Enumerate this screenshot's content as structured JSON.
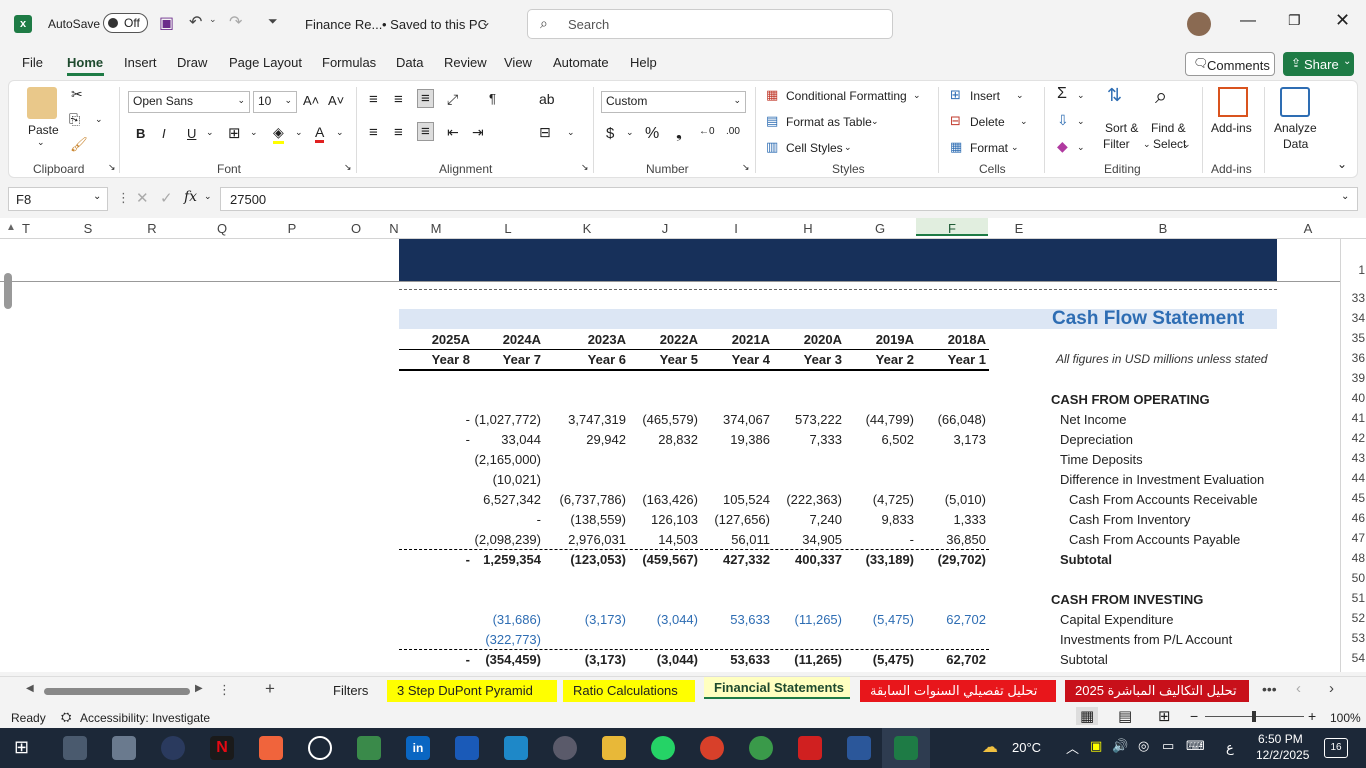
{
  "titlebar": {
    "autosave_label": "AutoSave",
    "autosave_state": "Off",
    "filename": "Finance Re...",
    "saved_status": "• Saved to this PC",
    "search_placeholder": "Search"
  },
  "ribbon_tabs": [
    "File",
    "Home",
    "Insert",
    "Draw",
    "Page Layout",
    "Formulas",
    "Data",
    "Review",
    "View",
    "Automate",
    "Help"
  ],
  "active_tab": "Home",
  "comments_label": "Comments",
  "share_label": "Share",
  "ribbon": {
    "clipboard": {
      "label": "Clipboard",
      "paste": "Paste"
    },
    "font": {
      "label": "Font",
      "name": "Open Sans",
      "size": "10"
    },
    "alignment": {
      "label": "Alignment"
    },
    "number": {
      "label": "Number",
      "format": "Custom"
    },
    "styles": {
      "label": "Styles",
      "conditional": "Conditional Formatting",
      "format_table": "Format as Table",
      "cell_styles": "Cell Styles"
    },
    "cells": {
      "label": "Cells",
      "insert": "Insert",
      "delete": "Delete",
      "format": "Format"
    },
    "editing": {
      "label": "Editing",
      "sort": "Sort &",
      "sort2": "Filter",
      "find": "Find &",
      "find2": "Select"
    },
    "addins": {
      "label": "Add-ins",
      "btn": "Add-ins"
    },
    "analyze": {
      "line1": "Analyze",
      "line2": "Data"
    }
  },
  "formula_bar": {
    "name_box": "F8",
    "fx": "fx",
    "value": "27500"
  },
  "columns": [
    "T",
    "S",
    "R",
    "Q",
    "P",
    "O",
    "N",
    "M",
    "L",
    "K",
    "J",
    "I",
    "H",
    "G",
    "F",
    "E",
    "B",
    "A"
  ],
  "rows": [
    "1",
    "33",
    "34",
    "35",
    "36",
    "39",
    "40",
    "41",
    "42",
    "43",
    "44",
    "45",
    "46",
    "47",
    "48",
    "50",
    "51",
    "52",
    "53",
    "54"
  ],
  "sheet": {
    "title": "Cash Flow Statement",
    "note": "All figures in USD millions unless stated",
    "years": [
      "2025A",
      "2024A",
      "2023A",
      "2022A",
      "2021A",
      "2020A",
      "2019A",
      "2018A"
    ],
    "year_labels": [
      "Year 8",
      "Year 7",
      "Year 6",
      "Year 5",
      "Year 4",
      "Year 3",
      "Year 2",
      "Year 1"
    ],
    "section_operating": "CASH FROM OPERATING",
    "section_investing": "CASH FROM INVESTING",
    "lines": [
      {
        "label": "Net Income",
        "values": [
          "-",
          "(1,027,772)",
          "3,747,319",
          "(465,579)",
          "374,067",
          "573,222",
          "(44,799)",
          "(66,048)"
        ]
      },
      {
        "label": "Depreciation",
        "values": [
          "-",
          "33,044",
          "29,942",
          "28,832",
          "19,386",
          "7,333",
          "6,502",
          "3,173"
        ]
      },
      {
        "label": "Time Deposits",
        "values": [
          "",
          "(2,165,000)",
          "",
          "",
          "",
          "",
          "",
          ""
        ]
      },
      {
        "label": "Difference in Investment Evaluation",
        "values": [
          "",
          "(10,021)",
          "",
          "",
          "",
          "",
          "",
          ""
        ]
      },
      {
        "label": "Cash From Accounts Receivable",
        "values": [
          "",
          "6,527,342",
          "(6,737,786)",
          "(163,426)",
          "105,524",
          "(222,363)",
          "(4,725)",
          "(5,010)"
        ]
      },
      {
        "label": "Cash From Inventory",
        "values": [
          "",
          "-",
          "(138,559)",
          "126,103",
          "(127,656)",
          "7,240",
          "9,833",
          "1,333"
        ]
      },
      {
        "label": "Cash From Accounts Payable",
        "values": [
          "",
          "(2,098,239)",
          "2,976,031",
          "14,503",
          "56,011",
          "34,905",
          "-",
          "36,850"
        ]
      },
      {
        "label": "Subtotal",
        "values": [
          "-",
          "1,259,354",
          "(123,053)",
          "(459,567)",
          "427,332",
          "400,337",
          "(33,189)",
          "(29,702)"
        ]
      },
      {
        "label": "Capital Expenditure",
        "values": [
          "",
          "(31,686)",
          "(3,173)",
          "(3,044)",
          "53,633",
          "(11,265)",
          "(5,475)",
          "62,702"
        ]
      },
      {
        "label": "Investments from P/L Account",
        "values": [
          "",
          "(322,773)",
          "",
          "",
          "",
          "",
          "",
          ""
        ]
      },
      {
        "label": "Subtotal",
        "values": [
          "-",
          "(354,459)",
          "(3,173)",
          "(3,044)",
          "53,633",
          "(11,265)",
          "(5,475)",
          "62,702"
        ]
      }
    ]
  },
  "sheet_tabs": [
    {
      "label": "Filters",
      "color": "#f3f3f3"
    },
    {
      "label": "3 Step DuPont Pyramid",
      "color": "#ffff00"
    },
    {
      "label": "Ratio Calculations",
      "color": "#ffff00"
    },
    {
      "label": "Financial Statements",
      "color": "#ffffc0"
    },
    {
      "label": "تحليل تفصيلي السنوات السابقة",
      "color": "#e8161b"
    },
    {
      "label": "تحليل التكاليف المباشرة 2025",
      "color": "#c8101a"
    }
  ],
  "status": {
    "ready": "Ready",
    "accessibility": "Accessibility: Investigate",
    "zoom": "100%"
  },
  "taskbar": {
    "weather": "20°C",
    "time": "6:50 PM",
    "date": "12/2/2025",
    "lang": "ع",
    "notif": "16"
  },
  "colors": {
    "header_band": "#17305a",
    "title_band": "#dce6f4",
    "accent_green": "#1e7b45",
    "blue_text": "#2e6db3"
  }
}
